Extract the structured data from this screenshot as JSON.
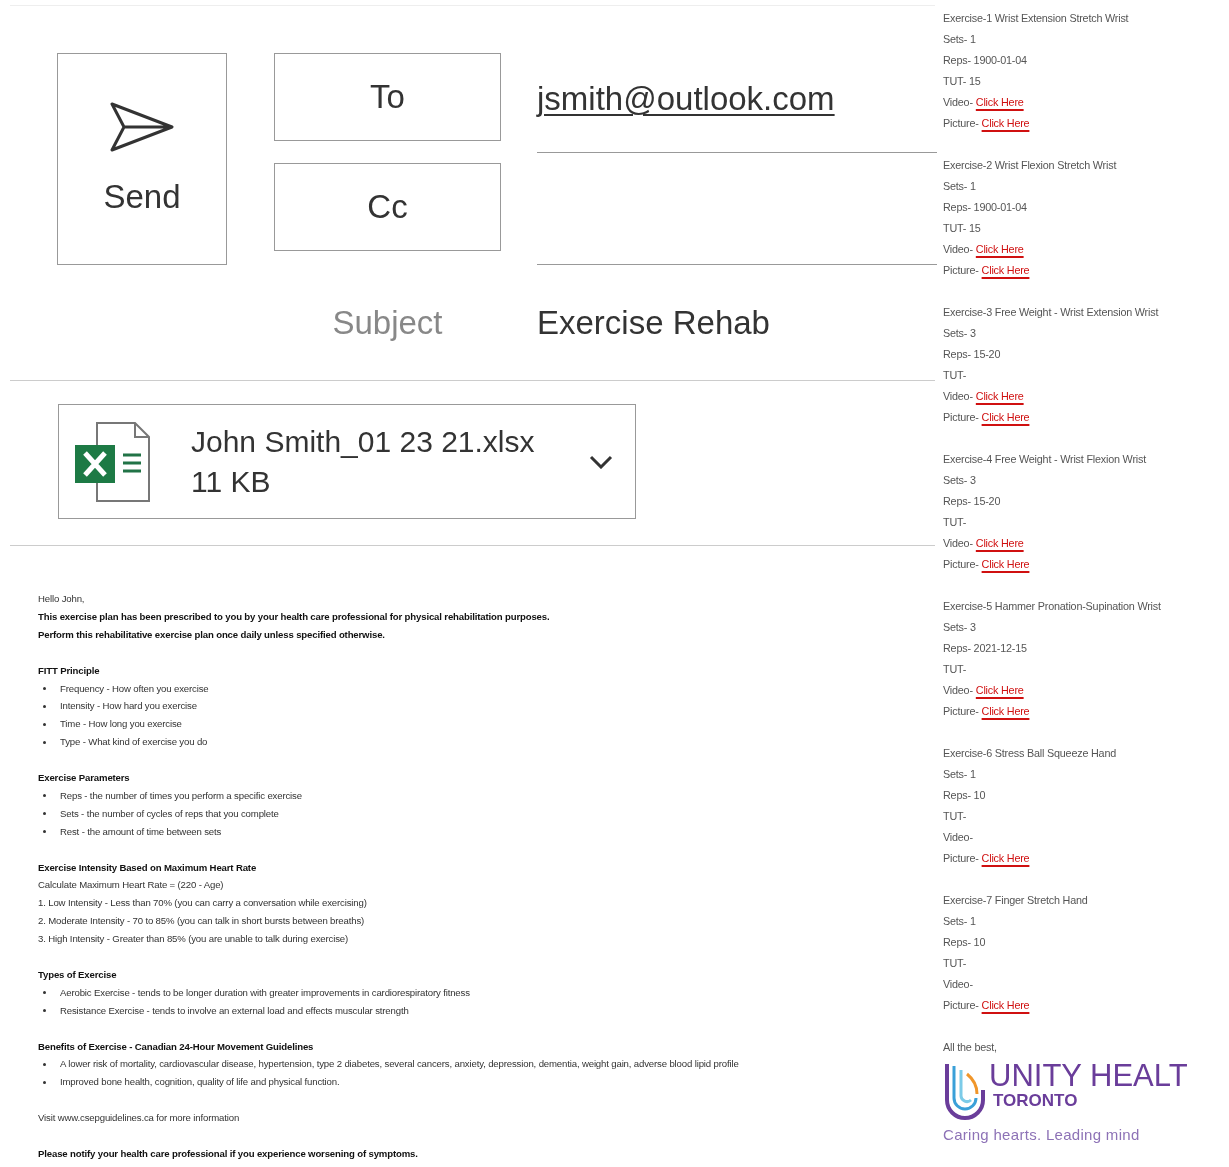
{
  "header": {
    "send_label": "Send",
    "to_label": "To",
    "cc_label": "Cc",
    "to_value": "jsmith@outlook.com",
    "subject_label": "Subject",
    "subject_value": "Exercise Rehab"
  },
  "attachment": {
    "name": "John Smith_01 23 21.xlsx",
    "size": "11 KB"
  },
  "body": [
    {
      "kind": "lines",
      "lines": [
        {
          "text": "Hello John,",
          "bold": false
        },
        {
          "text": "This exercise plan has been prescribed to you by your health care professional for physical rehabilitation purposes.",
          "bold": true
        },
        {
          "text": "Perform this rehabilitative exercise plan once daily unless specified otherwise.",
          "bold": true
        }
      ]
    },
    {
      "kind": "bullets",
      "heading": "FITT Principle",
      "items": [
        "Frequency - How often you exercise",
        "Intensity - How hard you exercise",
        "Time - How long you exercise",
        "Type - What kind of exercise you do"
      ]
    },
    {
      "kind": "bullets",
      "heading": "Exercise Parameters",
      "items": [
        "Reps - the number of times you perform a specific exercise",
        "Sets - the number of cycles of reps that you complete",
        "Rest - the amount of time between sets"
      ]
    },
    {
      "kind": "lines",
      "heading": "Exercise Intensity Based on Maximum Heart Rate",
      "lines": [
        {
          "text": "Calculate Maximum Heart Rate = (220 - Age)",
          "bold": false
        },
        {
          "text": "1. Low Intensity - Less than 70% (you can carry a conversation while exercising)",
          "bold": false
        },
        {
          "text": "2. Moderate Intensity - 70 to 85% (you can talk in short bursts between breaths)",
          "bold": false
        },
        {
          "text": "3. High Intensity - Greater than 85% (you are unable to talk during exercise)",
          "bold": false
        }
      ]
    },
    {
      "kind": "bullets",
      "heading": "Types of Exercise",
      "items": [
        "Aerobic Exercise - tends to be longer duration with greater improvements in cardiorespiratory fitness",
        "Resistance Exercise - tends to involve an external load and effects muscular strength"
      ]
    },
    {
      "kind": "bullets",
      "heading": "Benefits of Exercise - Canadian 24-Hour Movement Guidelines",
      "items": [
        "A lower risk of mortality, cardiovascular disease, hypertension, type 2 diabetes, several cancers, anxiety, depression, dementia, weight gain, adverse blood lipid profile",
        "Improved bone health, cognition, quality of life and physical function."
      ]
    },
    {
      "kind": "lines",
      "lines": [
        {
          "text": "Visit www.csepguidelines.ca for more information",
          "bold": false
        }
      ]
    },
    {
      "kind": "lines",
      "lines": [
        {
          "text": "Please notify your health care professional if you experience worsening of symptoms.",
          "bold": true
        }
      ]
    }
  ],
  "exercises": [
    {
      "title": "Exercise-1 Wrist Extension Stretch Wrist",
      "sets": "Sets- 1",
      "reps": "Reps- 1900-01-04",
      "tut": "TUT- 15",
      "video": {
        "label": "Video-",
        "link": "Click Here"
      },
      "picture": {
        "label": "Picture-",
        "link": "Click Here"
      }
    },
    {
      "title": "Exercise-2 Wrist Flexion Stretch Wrist",
      "sets": "Sets- 1",
      "reps": "Reps- 1900-01-04",
      "tut": "TUT- 15",
      "video": {
        "label": "Video-",
        "link": "Click Here"
      },
      "picture": {
        "label": "Picture-",
        "link": "Click Here"
      }
    },
    {
      "title": "Exercise-3 Free Weight - Wrist Extension Wrist",
      "sets": "Sets- 3",
      "reps": "Reps- 15-20",
      "tut": "TUT-",
      "video": {
        "label": "Video-",
        "link": "Click Here"
      },
      "picture": {
        "label": "Picture-",
        "link": "Click Here"
      }
    },
    {
      "title": "Exercise-4 Free Weight - Wrist Flexion Wrist",
      "sets": "Sets- 3",
      "reps": "Reps- 15-20",
      "tut": "TUT-",
      "video": {
        "label": "Video-",
        "link": "Click Here"
      },
      "picture": {
        "label": "Picture-",
        "link": "Click Here"
      }
    },
    {
      "title": "Exercise-5 Hammer Pronation-Supination Wrist",
      "sets": "Sets- 3",
      "reps": "Reps- 2021-12-15",
      "tut": "TUT-",
      "video": {
        "label": "Video-",
        "link": "Click Here"
      },
      "picture": {
        "label": "Picture-",
        "link": "Click Here"
      }
    },
    {
      "title": "Exercise-6 Stress Ball Squeeze Hand",
      "sets": "Sets- 1",
      "reps": "Reps- 10",
      "tut": "TUT-",
      "video": {
        "label": "Video-"
      },
      "picture": {
        "label": "Picture-",
        "link": "Click Here"
      }
    },
    {
      "title": "Exercise-7 Finger Stretch Hand",
      "sets": "Sets- 1",
      "reps": "Reps- 10",
      "tut": "TUT-",
      "video": {
        "label": "Video-"
      },
      "picture": {
        "label": "Picture-",
        "link": "Click Here"
      }
    }
  ],
  "signature": {
    "closing": "All the best,",
    "org": "UNITY HEALT",
    "city": "TORONTO",
    "tagline": "Caring hearts. Leading mind"
  }
}
